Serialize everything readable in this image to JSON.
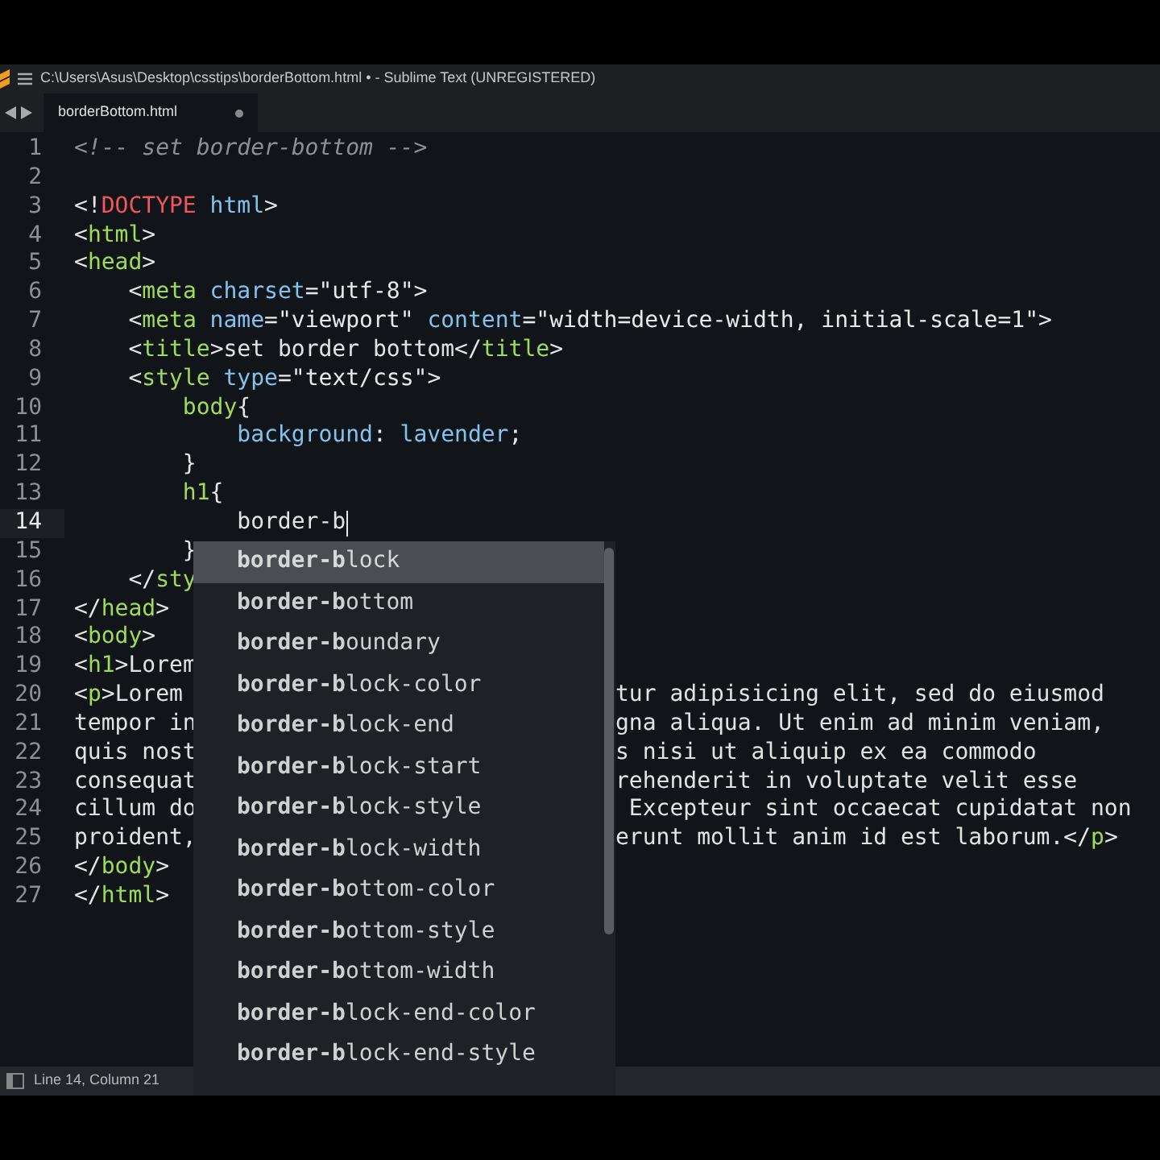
{
  "window": {
    "title": "C:\\Users\\Asus\\Desktop\\csstips\\borderBottom.html • - Sublime Text (UNREGISTERED)"
  },
  "tabs": [
    {
      "label": "borderBottom.html",
      "selected": true,
      "dirty": true
    }
  ],
  "editor": {
    "lines": [
      {
        "number": "1",
        "current": false,
        "left": [
          {
            "kind": "comment",
            "text": "<!-- set border-bottom -->"
          }
        ]
      },
      {
        "number": "2",
        "current": false
      },
      {
        "number": "3",
        "current": false,
        "left": [
          {
            "kind": "punct",
            "text": "<!"
          },
          {
            "kind": "doctype",
            "text": "DOCTYPE"
          },
          {
            "kind": "attr",
            "text": " html"
          },
          {
            "kind": "punct",
            "text": ">"
          }
        ]
      },
      {
        "number": "4",
        "current": false,
        "left": [
          {
            "kind": "punct",
            "text": "<"
          },
          {
            "kind": "tag",
            "text": "html"
          },
          {
            "kind": "punct",
            "text": ">"
          }
        ]
      },
      {
        "number": "5",
        "current": false,
        "left": [
          {
            "kind": "punct",
            "text": "<"
          },
          {
            "kind": "tag",
            "text": "head"
          },
          {
            "kind": "punct",
            "text": ">"
          }
        ]
      },
      {
        "number": "6",
        "current": false,
        "left": [
          {
            "kind": "punct",
            "text": "    <"
          },
          {
            "kind": "tag",
            "text": "meta"
          },
          {
            "kind": "attr",
            "text": " charset"
          },
          {
            "kind": "punct",
            "text": "="
          },
          {
            "kind": "string",
            "text": "\"utf-8\""
          },
          {
            "kind": "punct",
            "text": ">"
          }
        ]
      },
      {
        "number": "7",
        "current": false,
        "left": [
          {
            "kind": "punct",
            "text": "    <"
          },
          {
            "kind": "tag",
            "text": "meta"
          },
          {
            "kind": "attr",
            "text": " name"
          },
          {
            "kind": "punct",
            "text": "="
          },
          {
            "kind": "string",
            "text": "\"viewport\""
          },
          {
            "kind": "attr",
            "text": " content"
          },
          {
            "kind": "punct",
            "text": "="
          },
          {
            "kind": "string",
            "text": "\"width=device-width, initial-scale=1\""
          },
          {
            "kind": "punct",
            "text": ">"
          }
        ]
      },
      {
        "number": "8",
        "current": false,
        "left": [
          {
            "kind": "punct",
            "text": "    <"
          },
          {
            "kind": "tag",
            "text": "title"
          },
          {
            "kind": "punct",
            "text": ">"
          },
          {
            "kind": "text",
            "text": "set border bottom"
          },
          {
            "kind": "punct",
            "text": "</"
          },
          {
            "kind": "tag",
            "text": "title"
          },
          {
            "kind": "punct",
            "text": ">"
          }
        ]
      },
      {
        "number": "9",
        "current": false,
        "left": [
          {
            "kind": "punct",
            "text": "    <"
          },
          {
            "kind": "tag",
            "text": "style"
          },
          {
            "kind": "attr",
            "text": " type"
          },
          {
            "kind": "punct",
            "text": "="
          },
          {
            "kind": "string",
            "text": "\"text/css\""
          },
          {
            "kind": "punct",
            "text": ">"
          }
        ]
      },
      {
        "number": "10",
        "current": false,
        "left": [
          {
            "kind": "tag",
            "text": "        body"
          },
          {
            "kind": "punct",
            "text": "{"
          }
        ]
      },
      {
        "number": "11",
        "current": false,
        "left": [
          {
            "kind": "attr",
            "text": "            background"
          },
          {
            "kind": "punct",
            "text": ": "
          },
          {
            "kind": "attr",
            "text": "lavender"
          },
          {
            "kind": "punct",
            "text": ";"
          }
        ]
      },
      {
        "number": "12",
        "current": false,
        "left": [
          {
            "kind": "punct",
            "text": "        }"
          }
        ]
      },
      {
        "number": "13",
        "current": false,
        "left": [
          {
            "kind": "tag",
            "text": "        h1"
          },
          {
            "kind": "punct",
            "text": "{"
          }
        ]
      },
      {
        "number": "14",
        "current": true,
        "left": [
          {
            "kind": "text",
            "text": "            border-b"
          }
        ]
      },
      {
        "number": "15",
        "current": false,
        "left": [
          {
            "kind": "punct",
            "text": "        }"
          }
        ]
      },
      {
        "number": "16",
        "current": false,
        "left": [
          {
            "kind": "punct",
            "text": "    </"
          },
          {
            "kind": "tag",
            "text": "sty"
          }
        ]
      },
      {
        "number": "17",
        "current": false,
        "left": [
          {
            "kind": "punct",
            "text": "</"
          },
          {
            "kind": "tag",
            "text": "head"
          },
          {
            "kind": "punct",
            "text": ">"
          }
        ]
      },
      {
        "number": "18",
        "current": false,
        "left": [
          {
            "kind": "punct",
            "text": "<"
          },
          {
            "kind": "tag",
            "text": "body"
          },
          {
            "kind": "punct",
            "text": ">"
          }
        ]
      },
      {
        "number": "19",
        "current": false,
        "left": [
          {
            "kind": "punct",
            "text": "<"
          },
          {
            "kind": "tag",
            "text": "h1"
          },
          {
            "kind": "punct",
            "text": ">"
          },
          {
            "kind": "text",
            "text": "Lorem"
          }
        ]
      },
      {
        "number": "20",
        "current": false,
        "left": [
          {
            "kind": "punct",
            "text": "<"
          },
          {
            "kind": "tag",
            "text": "p"
          },
          {
            "kind": "punct",
            "text": ">"
          },
          {
            "kind": "text",
            "text": "Lorem"
          }
        ],
        "right": [
          {
            "kind": "text",
            "text": "tur adipisicing elit, sed do eiusmod"
          }
        ]
      },
      {
        "number": "21",
        "current": false,
        "left": [
          {
            "kind": "text",
            "text": "tempor in"
          }
        ],
        "right": [
          {
            "kind": "text",
            "text": "gna aliqua. Ut enim ad minim veniam,"
          }
        ]
      },
      {
        "number": "22",
        "current": false,
        "left": [
          {
            "kind": "text",
            "text": "quis nost"
          }
        ],
        "right": [
          {
            "kind": "text",
            "text": "s nisi ut aliquip ex ea commodo"
          }
        ]
      },
      {
        "number": "23",
        "current": false,
        "left": [
          {
            "kind": "text",
            "text": "consequat"
          }
        ],
        "right": [
          {
            "kind": "text",
            "text": "rehenderit in voluptate velit esse"
          }
        ]
      },
      {
        "number": "24",
        "current": false,
        "left": [
          {
            "kind": "text",
            "text": "cillum do"
          }
        ],
        "right": [
          {
            "kind": "text",
            "text": " Excepteur sint occaecat cupidatat non"
          }
        ]
      },
      {
        "number": "25",
        "current": false,
        "left": [
          {
            "kind": "text",
            "text": "proident,"
          }
        ],
        "right": [
          {
            "kind": "text",
            "text": "erunt mollit anim id est laborum."
          },
          {
            "kind": "punct",
            "text": "</"
          },
          {
            "kind": "tag",
            "text": "p"
          },
          {
            "kind": "punct",
            "text": ">"
          }
        ]
      },
      {
        "number": "26",
        "current": false,
        "left": [
          {
            "kind": "punct",
            "text": "</"
          },
          {
            "kind": "tag",
            "text": "body"
          },
          {
            "kind": "punct",
            "text": ">"
          }
        ]
      },
      {
        "number": "27",
        "current": false,
        "left": [
          {
            "kind": "punct",
            "text": "</"
          },
          {
            "kind": "tag",
            "text": "html"
          },
          {
            "kind": "punct",
            "text": ">"
          }
        ]
      }
    ]
  },
  "autocomplete": {
    "items": [
      {
        "label": "**border-b**lock",
        "selected": true
      },
      {
        "label": "**border-b**ottom",
        "selected": false
      },
      {
        "label": "**border-b**oundary",
        "selected": false
      },
      {
        "label": "**border-b**lock-color",
        "selected": false
      },
      {
        "label": "**border-b**lock-end",
        "selected": false
      },
      {
        "label": "**border-b**lock-start",
        "selected": false
      },
      {
        "label": "**border-b**lock-style",
        "selected": false
      },
      {
        "label": "**border-b**lock-width",
        "selected": false
      },
      {
        "label": "**border-b**ottom-color",
        "selected": false
      },
      {
        "label": "**border-b**ottom-style",
        "selected": false
      },
      {
        "label": "**border-b**ottom-width",
        "selected": false
      },
      {
        "label": "**border-b**lock-end-color",
        "selected": false
      },
      {
        "label": "**border-b**lock-end-style",
        "selected": false
      }
    ]
  },
  "status_bar": {
    "position": "Line 14, Column 21"
  }
}
